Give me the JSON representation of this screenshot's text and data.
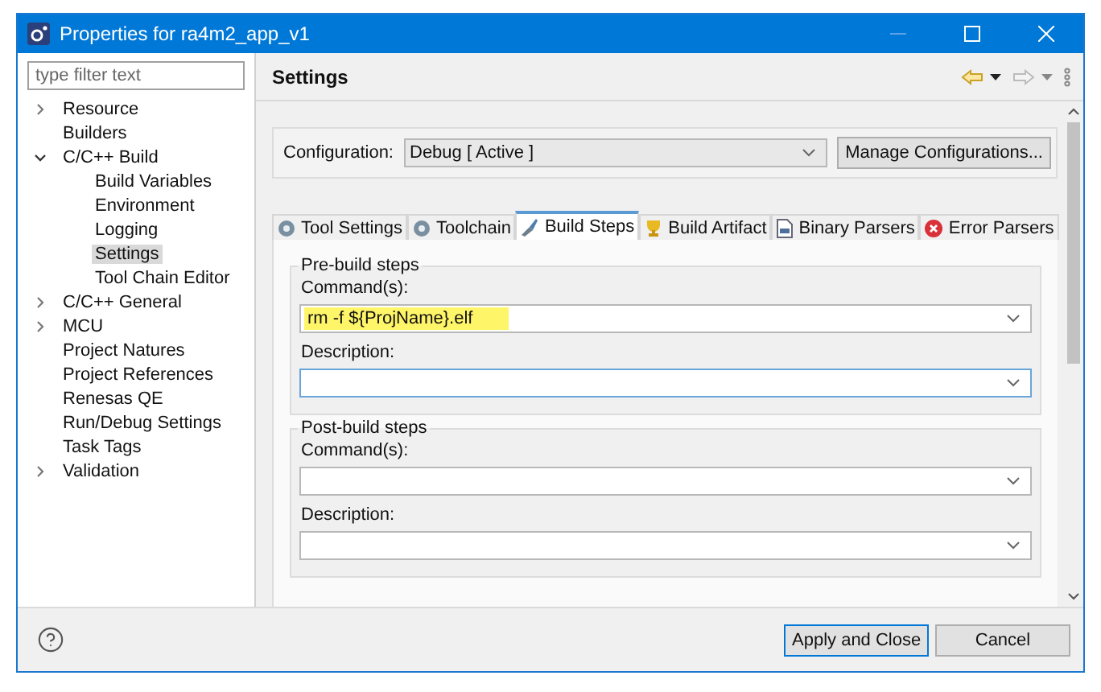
{
  "window": {
    "title": "Properties for ra4m2_app_v1"
  },
  "filter": {
    "placeholder": "type filter text"
  },
  "tree": [
    {
      "label": "Resource",
      "expanded": false,
      "selected": false
    },
    {
      "label": "Builders",
      "selected": false
    },
    {
      "label": "C/C++ Build",
      "expanded": true,
      "selected": false,
      "children": [
        {
          "label": "Build Variables",
          "selected": false
        },
        {
          "label": "Environment",
          "selected": false
        },
        {
          "label": "Logging",
          "selected": false
        },
        {
          "label": "Settings",
          "selected": true
        },
        {
          "label": "Tool Chain Editor",
          "selected": false
        }
      ]
    },
    {
      "label": "C/C++ General",
      "expanded": false,
      "selected": false
    },
    {
      "label": "MCU",
      "expanded": false,
      "selected": false
    },
    {
      "label": "Project Natures",
      "selected": false
    },
    {
      "label": "Project References",
      "selected": false
    },
    {
      "label": "Renesas QE",
      "selected": false
    },
    {
      "label": "Run/Debug Settings",
      "selected": false
    },
    {
      "label": "Task Tags",
      "selected": false
    },
    {
      "label": "Validation",
      "expanded": false,
      "selected": false
    }
  ],
  "page": {
    "title": "Settings"
  },
  "configuration": {
    "label": "Configuration:",
    "value": "Debug  [ Active ]",
    "button": "Manage Configurations..."
  },
  "tabs": [
    {
      "label": "Tool Settings",
      "kind": "gear",
      "selected": false
    },
    {
      "label": "Toolchain",
      "kind": "gear",
      "selected": false
    },
    {
      "label": "Build Steps",
      "kind": "brush",
      "selected": true
    },
    {
      "label": "Build Artifact",
      "kind": "trophy",
      "selected": false
    },
    {
      "label": "Binary Parsers",
      "kind": "file",
      "selected": false
    },
    {
      "label": "Error Parsers",
      "kind": "error",
      "selected": false
    }
  ],
  "groups": [
    {
      "title": "Pre-build steps",
      "fields": [
        {
          "label": "Command(s):",
          "value": "rm -f ${ProjName}.elf",
          "highlighted": true,
          "focused": false
        },
        {
          "label": "Description:",
          "focused": true
        }
      ]
    },
    {
      "title": "Post-build steps",
      "fields": [
        {
          "label": "Command(s):",
          "focused": false
        },
        {
          "label": "Description:",
          "focused": false
        }
      ]
    }
  ],
  "buttons": [
    {
      "label": "Apply and Close",
      "default": true
    },
    {
      "label": "Cancel",
      "default": false
    }
  ]
}
